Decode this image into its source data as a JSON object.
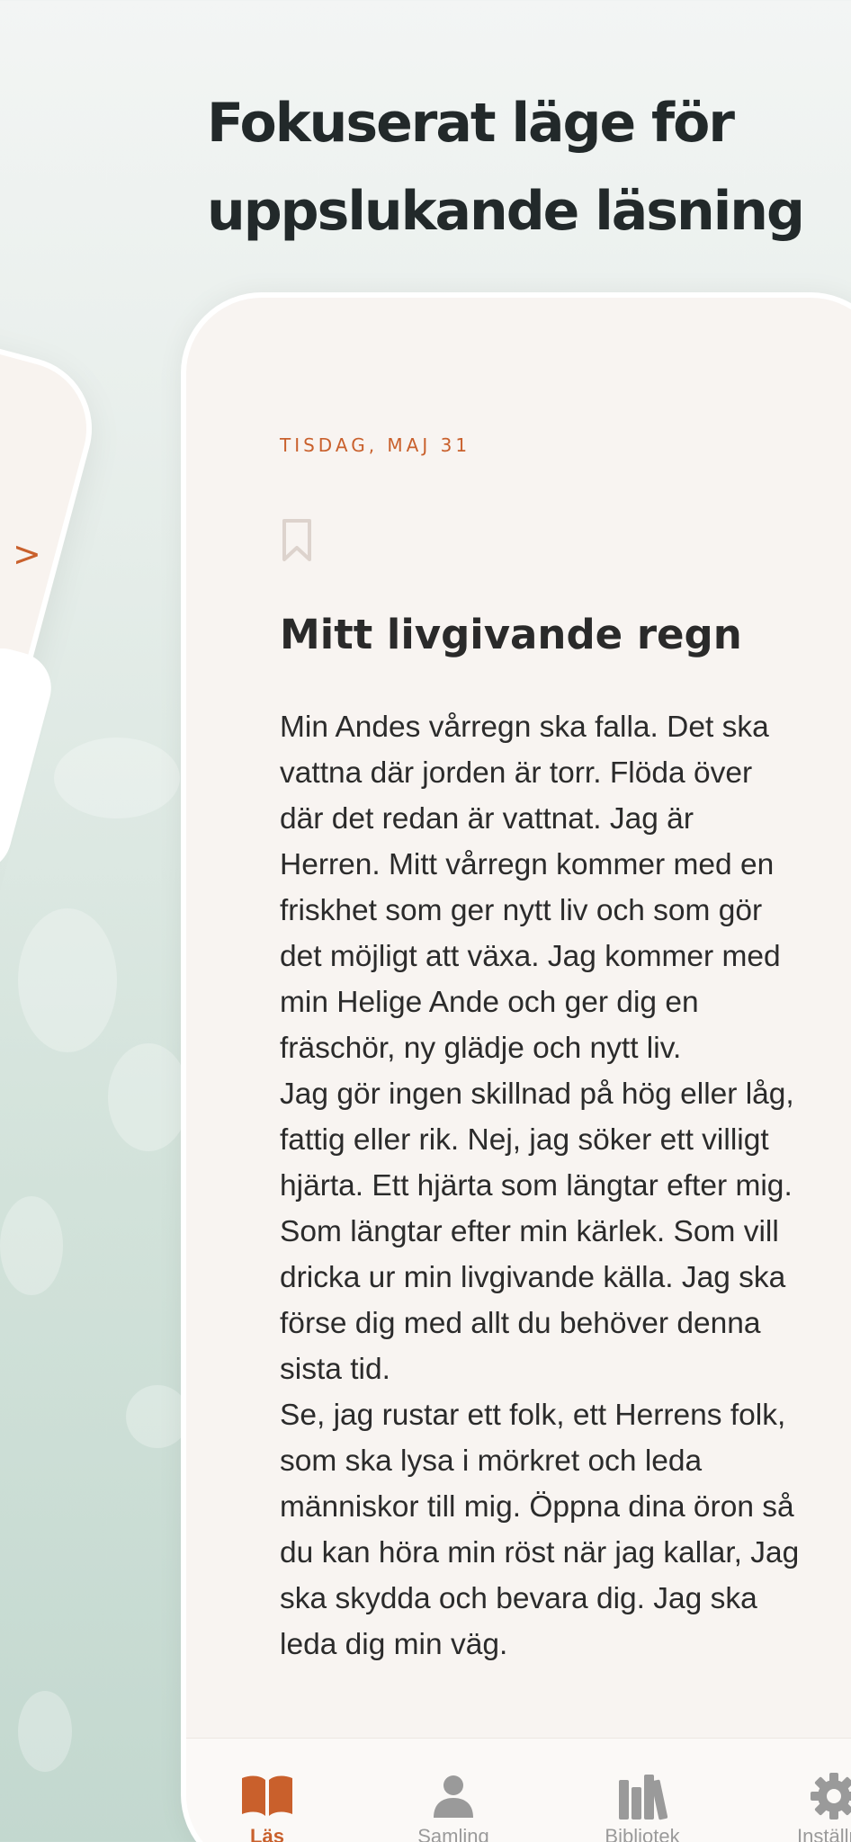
{
  "marketing": {
    "headline_line1": "Fokuserat läge för",
    "headline_line2": "uppslukande läsning"
  },
  "back_screen": {
    "chevron": ">"
  },
  "devotional": {
    "date": "TISDAG, MAJ 31",
    "title": "Mitt livgivande regn",
    "lines": [
      "Min Andes vårregn ska falla. Det ska",
      "vattna där jorden är torr. Flöda över",
      "där det redan är vattnat. Jag är",
      "Herren. Mitt vårregn kommer med en",
      "friskhet som ger nytt liv och som gör",
      "det möjligt att växa. Jag kommer med",
      "min Helige Ande och ger dig en",
      "fräschör, ny glädje och nytt liv.",
      "Jag gör ingen skillnad på hög eller låg,",
      "fattig eller rik. Nej, jag söker ett villigt",
      "hjärta. Ett hjärta som längtar efter mig.",
      "Som längtar efter min kärlek. Som vill",
      "dricka ur min livgivande källa. Jag ska",
      "förse dig med allt du behöver denna",
      "sista tid.",
      "Se, jag rustar ett folk, ett Herrens folk,",
      "som ska lysa i mörkret och leda",
      "människor till mig. Öppna dina öron så",
      "du kan höra min röst när jag kallar, Jag",
      "ska skydda och bevara dig. Jag ska",
      "leda dig min väg."
    ]
  },
  "tabs": [
    {
      "label": "Läs",
      "icon": "book-open-icon",
      "active": true
    },
    {
      "label": "Samling",
      "icon": "person-icon",
      "active": false
    },
    {
      "label": "Bibliotek",
      "icon": "library-icon",
      "active": false
    },
    {
      "label": "Inställnir",
      "icon": "gear-icon",
      "active": false
    }
  ],
  "colors": {
    "accent": "#c9602c",
    "inactive_tab": "#9a9a9a",
    "text": "#2b2b2b",
    "card_bg": "#f8f4f1"
  }
}
